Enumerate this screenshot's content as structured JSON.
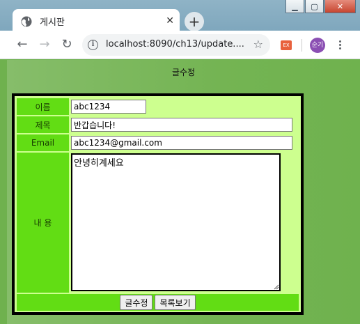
{
  "browser": {
    "tab_title": "게시판",
    "new_tab_icon": "plus-icon",
    "url": "localhost:8090/ch13/update....",
    "profile_initial": "순기",
    "extension_label": "EX",
    "colors": {
      "frame": "#8fb3c6",
      "extension": "#e8613d",
      "avatar": "#8b4fb3"
    }
  },
  "page": {
    "title": "글수정",
    "background": "#74b453"
  },
  "form": {
    "name_label": "이름",
    "name_value": "abc1234",
    "subject_label": "제목",
    "subject_value": "반갑습니다!",
    "email_label": "Email",
    "email_value": "abc1234@gmail.com",
    "content_label": "내 용",
    "content_value": "안녕히계세요",
    "colors": {
      "label_bg": "#62dd14",
      "cell_bg": "#cdff8f",
      "border": "#000000"
    }
  },
  "buttons": {
    "submit_label": "글수정",
    "list_label": "목록보기"
  }
}
